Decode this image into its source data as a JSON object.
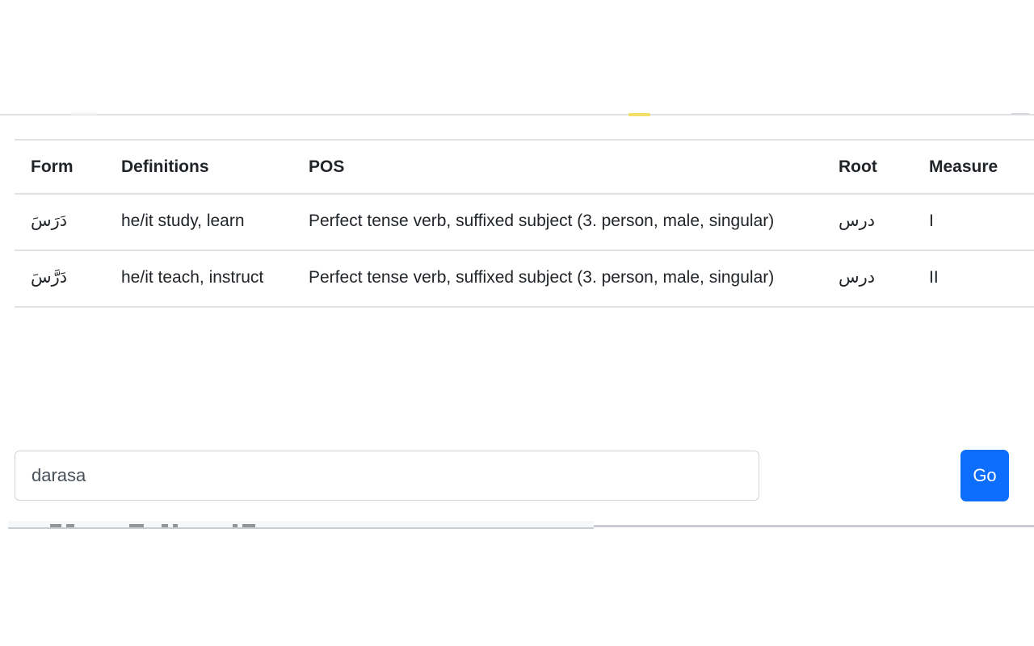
{
  "table": {
    "headers": {
      "form": "Form",
      "definitions": "Definitions",
      "pos": "POS",
      "root": "Root",
      "measure": "Measure"
    },
    "rows": [
      {
        "form": "دَرَسَ",
        "definitions": "he/it study, learn",
        "pos": "Perfect tense verb, suffixed subject (3. person, male, singular)",
        "root": "درس",
        "measure": "I"
      },
      {
        "form": "دَرَّسَ",
        "definitions": "he/it teach, instruct",
        "pos": "Perfect tense verb, suffixed subject (3. person, male, singular)",
        "root": "درس",
        "measure": "II"
      }
    ]
  },
  "search": {
    "value": "darasa",
    "placeholder": "",
    "submit_label": "Go"
  },
  "colors": {
    "accent": "#0d6efd",
    "text": "#212529",
    "border": "#dee2e6",
    "input_border": "#ced4da",
    "highlight": "#f2e06a"
  }
}
